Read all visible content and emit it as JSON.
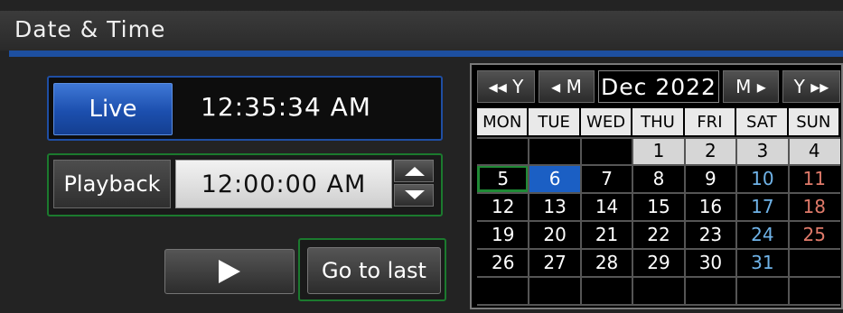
{
  "window": {
    "title": "Date & Time"
  },
  "live": {
    "button_label": "Live",
    "time": "12:35:34 AM"
  },
  "playback": {
    "label": "Playback",
    "time": "12:00:00 AM"
  },
  "controls": {
    "play_icon": "play-icon",
    "go_to_last_label": "Go to last"
  },
  "calendar": {
    "nav": {
      "prev_year": "◂◂ Y",
      "prev_month": "◂ M",
      "month_label": "Dec 2022",
      "next_month": "M ▸",
      "next_year": "Y ▸▸"
    },
    "weekdays": [
      "MON",
      "TUE",
      "WED",
      "THU",
      "FRI",
      "SAT",
      "SUN"
    ],
    "weeks": [
      [
        "",
        "",
        "",
        "1",
        "2",
        "3",
        "4"
      ],
      [
        "5",
        "6",
        "7",
        "8",
        "9",
        "10",
        "11"
      ],
      [
        "12",
        "13",
        "14",
        "15",
        "16",
        "17",
        "18"
      ],
      [
        "19",
        "20",
        "21",
        "22",
        "23",
        "24",
        "25"
      ],
      [
        "26",
        "27",
        "28",
        "29",
        "30",
        "31",
        ""
      ],
      [
        "",
        "",
        "",
        "",
        "",
        "",
        ""
      ]
    ],
    "today": "5",
    "selected": "6",
    "colors": {
      "saturday": "#6fb3e8",
      "sunday": "#e07a6a",
      "selected": "#1b5fc4",
      "today_outline": "#1f8a35"
    }
  }
}
